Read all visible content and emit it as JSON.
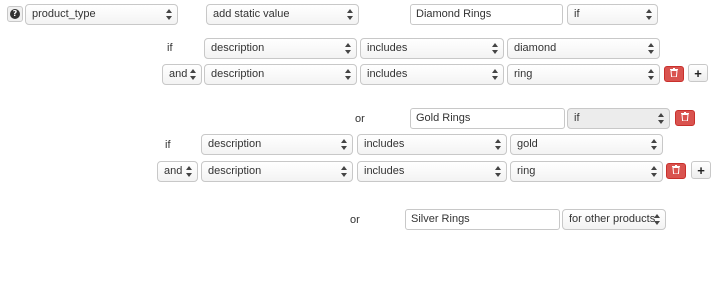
{
  "header": {
    "help_icon": "question-circle-icon",
    "field": "product_type",
    "action": "add static value",
    "value": "Diamond Rings",
    "condition": "if"
  },
  "group1": {
    "if_label": "if",
    "rows": [
      {
        "field": "description",
        "operator": "includes",
        "value": "diamond"
      },
      {
        "connector": "and",
        "field": "description",
        "operator": "includes",
        "value": "ring"
      }
    ]
  },
  "group2": {
    "or_label": "or",
    "value": "Gold Rings",
    "condition": "if",
    "if_label": "if",
    "rows": [
      {
        "field": "description",
        "operator": "includes",
        "value": "gold"
      },
      {
        "connector": "and",
        "field": "description",
        "operator": "includes",
        "value": "ring"
      }
    ]
  },
  "group3": {
    "or_label": "or",
    "value": "Silver Rings",
    "condition": "for other products"
  },
  "buttons": {
    "add_label": "+"
  },
  "colors": {
    "delete_button": "#d9534f",
    "border": "#c8c8c8"
  }
}
